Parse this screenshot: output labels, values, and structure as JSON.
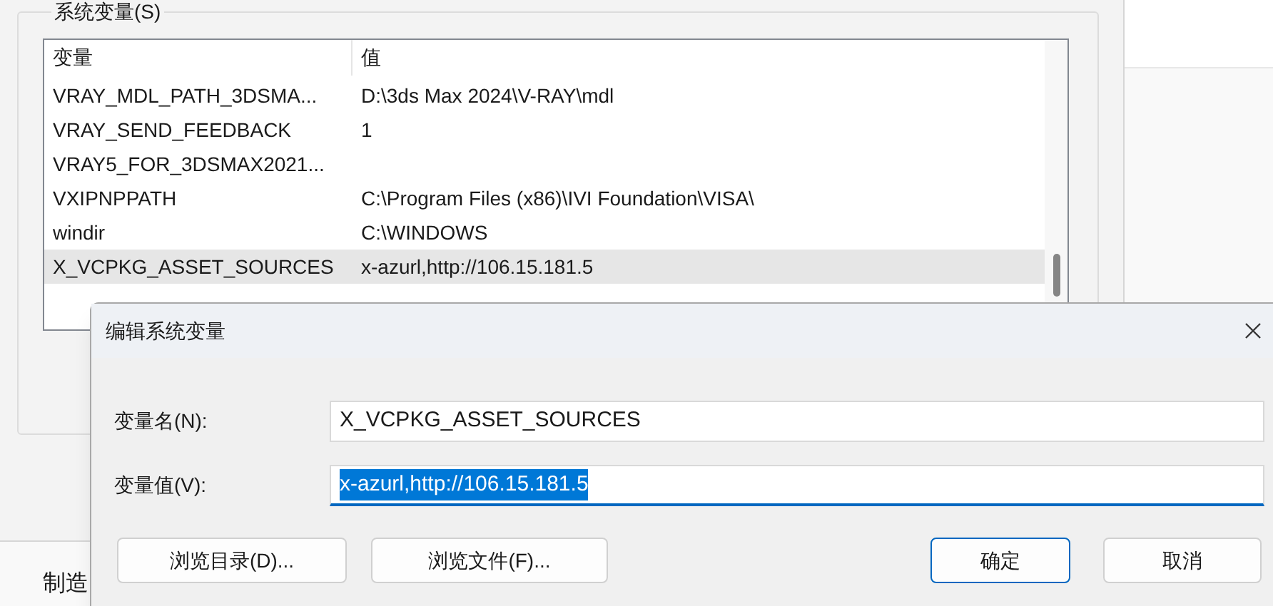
{
  "group": {
    "title": "系统变量(S)"
  },
  "list": {
    "columns": [
      "变量",
      "值"
    ],
    "rows": [
      {
        "name": "VRAY_MDL_PATH_3DSMA...",
        "value": "D:\\3ds Max 2024\\V-RAY\\mdl",
        "selected": false
      },
      {
        "name": "VRAY_SEND_FEEDBACK",
        "value": "1",
        "selected": false
      },
      {
        "name": "VRAY5_FOR_3DSMAX2021...",
        "selected": false
      },
      {
        "name": "VXIPNPPATH",
        "value": "C:\\Program Files (x86)\\IVI Foundation\\VISA\\",
        "selected": false
      },
      {
        "name": "windir",
        "value": "C:\\WINDOWS",
        "selected": false
      },
      {
        "name": "X_VCPKG_ASSET_SOURCES",
        "value": "x-azurl,http://106.15.181.5",
        "selected": true
      }
    ]
  },
  "footer_text": "制造",
  "dialog": {
    "title": "编辑系统变量",
    "fields": [
      {
        "label": "变量名(N):",
        "value": "X_VCPKG_ASSET_SOURCES",
        "focused": false
      },
      {
        "label": "变量值(V):",
        "value": "x-azurl,http://106.15.181.5",
        "focused": true
      }
    ],
    "browse_buttons": [
      {
        "label": "浏览目录(D)...",
        "default": false
      },
      {
        "label": "浏览文件(F)...",
        "default": false
      }
    ],
    "action_buttons": [
      {
        "label": "确定",
        "default": true
      },
      {
        "label": "取消",
        "default": false
      }
    ]
  }
}
